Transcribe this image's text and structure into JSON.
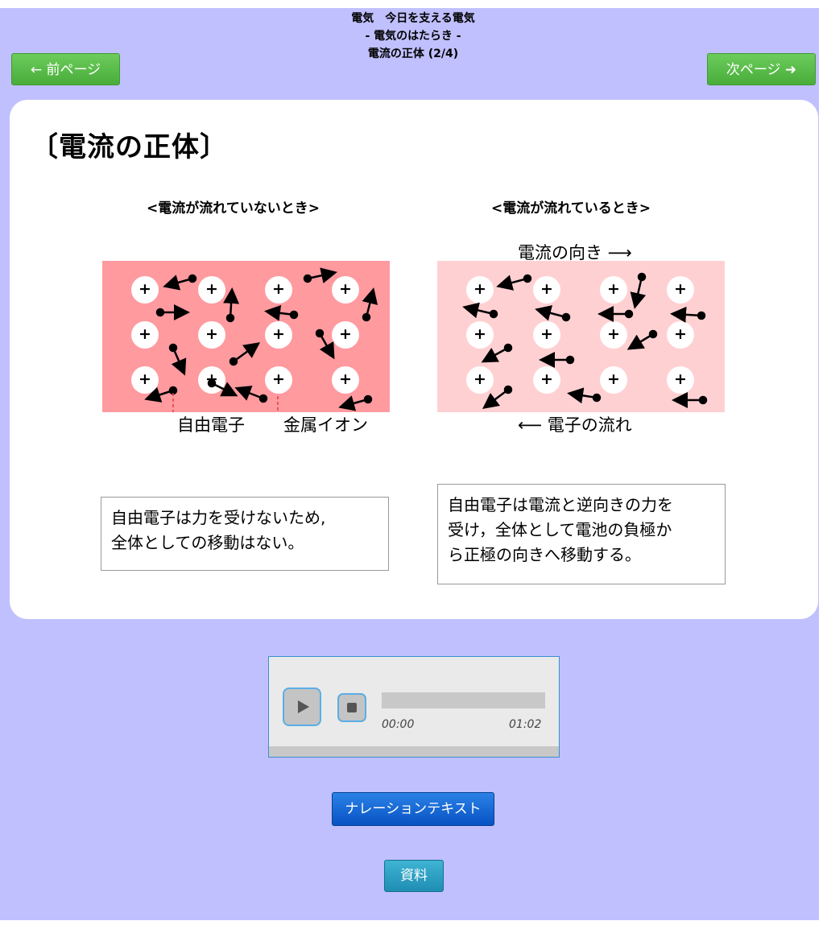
{
  "header": {
    "line1": "電気　今日を支える電気",
    "line2": "- 電気のはたらき -",
    "line3": "電流の正体 (2/4)"
  },
  "nav": {
    "prev_label": "← 前ページ",
    "next_label": "次ページ ➜"
  },
  "content": {
    "title": "〔電流の正体〕",
    "left_diagram": {
      "label": "<電流が流れていないとき>",
      "free_electron_label": "自由電子",
      "metal_ion_label": "金属イオン",
      "explanation_lines": [
        "自由電子は力を受けないため,",
        "全体としての移動はない。"
      ]
    },
    "right_diagram": {
      "label": "<電流が流れているとき>",
      "current_direction": "電流の向き ⟶",
      "electron_flow": "⟵ 電子の流れ",
      "explanation_lines": [
        "自由電子は電流と逆向きの力を",
        "受け，全体として電池の負極か",
        "ら正極の向きへ移動する。"
      ]
    },
    "ion_symbol": "+",
    "colors": {
      "panel_left": "#ff9a9f",
      "panel_right": "#ffd0d2",
      "background": "#c0c0ff"
    }
  },
  "player": {
    "current_time": "00:00",
    "total_time": "01:02",
    "progress": 0
  },
  "buttons": {
    "narration": "ナレーションテキスト",
    "material": "資料"
  }
}
